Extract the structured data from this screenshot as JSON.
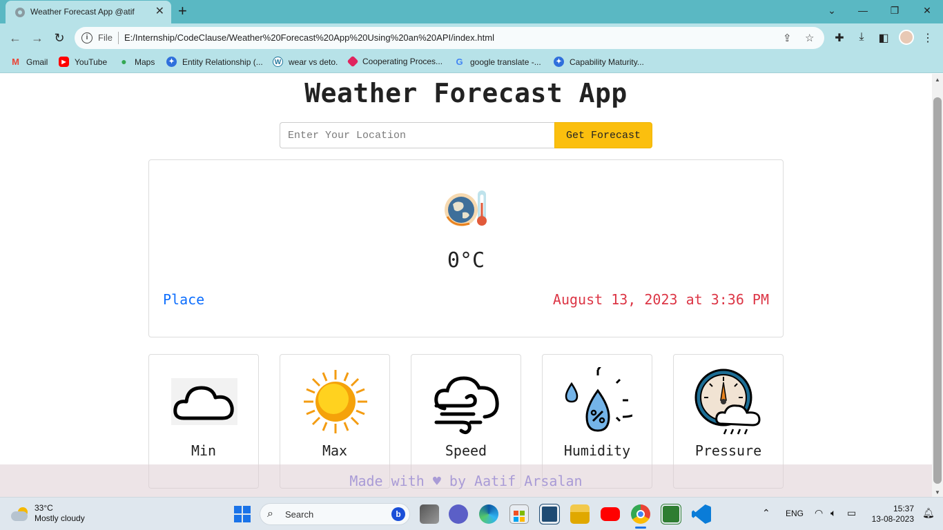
{
  "browser": {
    "tab_title": "Weather Forecast App @atif",
    "tab_close": "✕",
    "new_tab": "+",
    "omnibox_scheme": "File",
    "url": "E:/Internship/CodeClause/Weather%20Forecast%20App%20Using%20an%20API/index.html"
  },
  "bookmarks": [
    {
      "label": "Gmail",
      "icon": "gmail-icon",
      "color": "#ea4335"
    },
    {
      "label": "YouTube",
      "icon": "youtube-icon",
      "color": "#ff0000"
    },
    {
      "label": "Maps",
      "icon": "maps-icon",
      "color": "#34a853"
    },
    {
      "label": "Entity Relationship (...",
      "icon": "bookmark-site-icon",
      "color": "#2f6fdc"
    },
    {
      "label": "wear vs deto.",
      "icon": "wordpress-icon",
      "color": "#21759b"
    },
    {
      "label": "Cooperating Proces...",
      "icon": "bookmark-site-icon",
      "color": "#e0245e"
    },
    {
      "label": "google translate -...",
      "icon": "google-icon",
      "color": "#4285f4"
    },
    {
      "label": "Capability Maturity...",
      "icon": "bookmark-site-icon",
      "color": "#2f6fdc"
    }
  ],
  "app": {
    "title": "Weather Forecast App",
    "search_placeholder": "Enter Your Location",
    "search_button": "Get Forecast",
    "temperature": "0°C",
    "place": "Place",
    "datetime": "August 13, 2023 at 3:36 PM",
    "cards": [
      {
        "label": "Min",
        "icon": "cloud-icon"
      },
      {
        "label": "Max",
        "icon": "sun-icon"
      },
      {
        "label": "Speed",
        "icon": "wind-icon"
      },
      {
        "label": "Humidity",
        "icon": "humidity-icon"
      },
      {
        "label": "Pressure",
        "icon": "pressure-gauge-icon"
      }
    ],
    "footer": "Made with ♥ by Aatif Arsalan",
    "colors": {
      "accent": "#fbbf0e",
      "place": "#0d6efd",
      "datetime": "#dc3545",
      "footer_text": "#a99bd6"
    }
  },
  "taskbar": {
    "weather_temp": "33°C",
    "weather_desc": "Mostly cloudy",
    "search_label": "Search",
    "language": "ENG",
    "time": "15:37",
    "date": "13-08-2023"
  }
}
